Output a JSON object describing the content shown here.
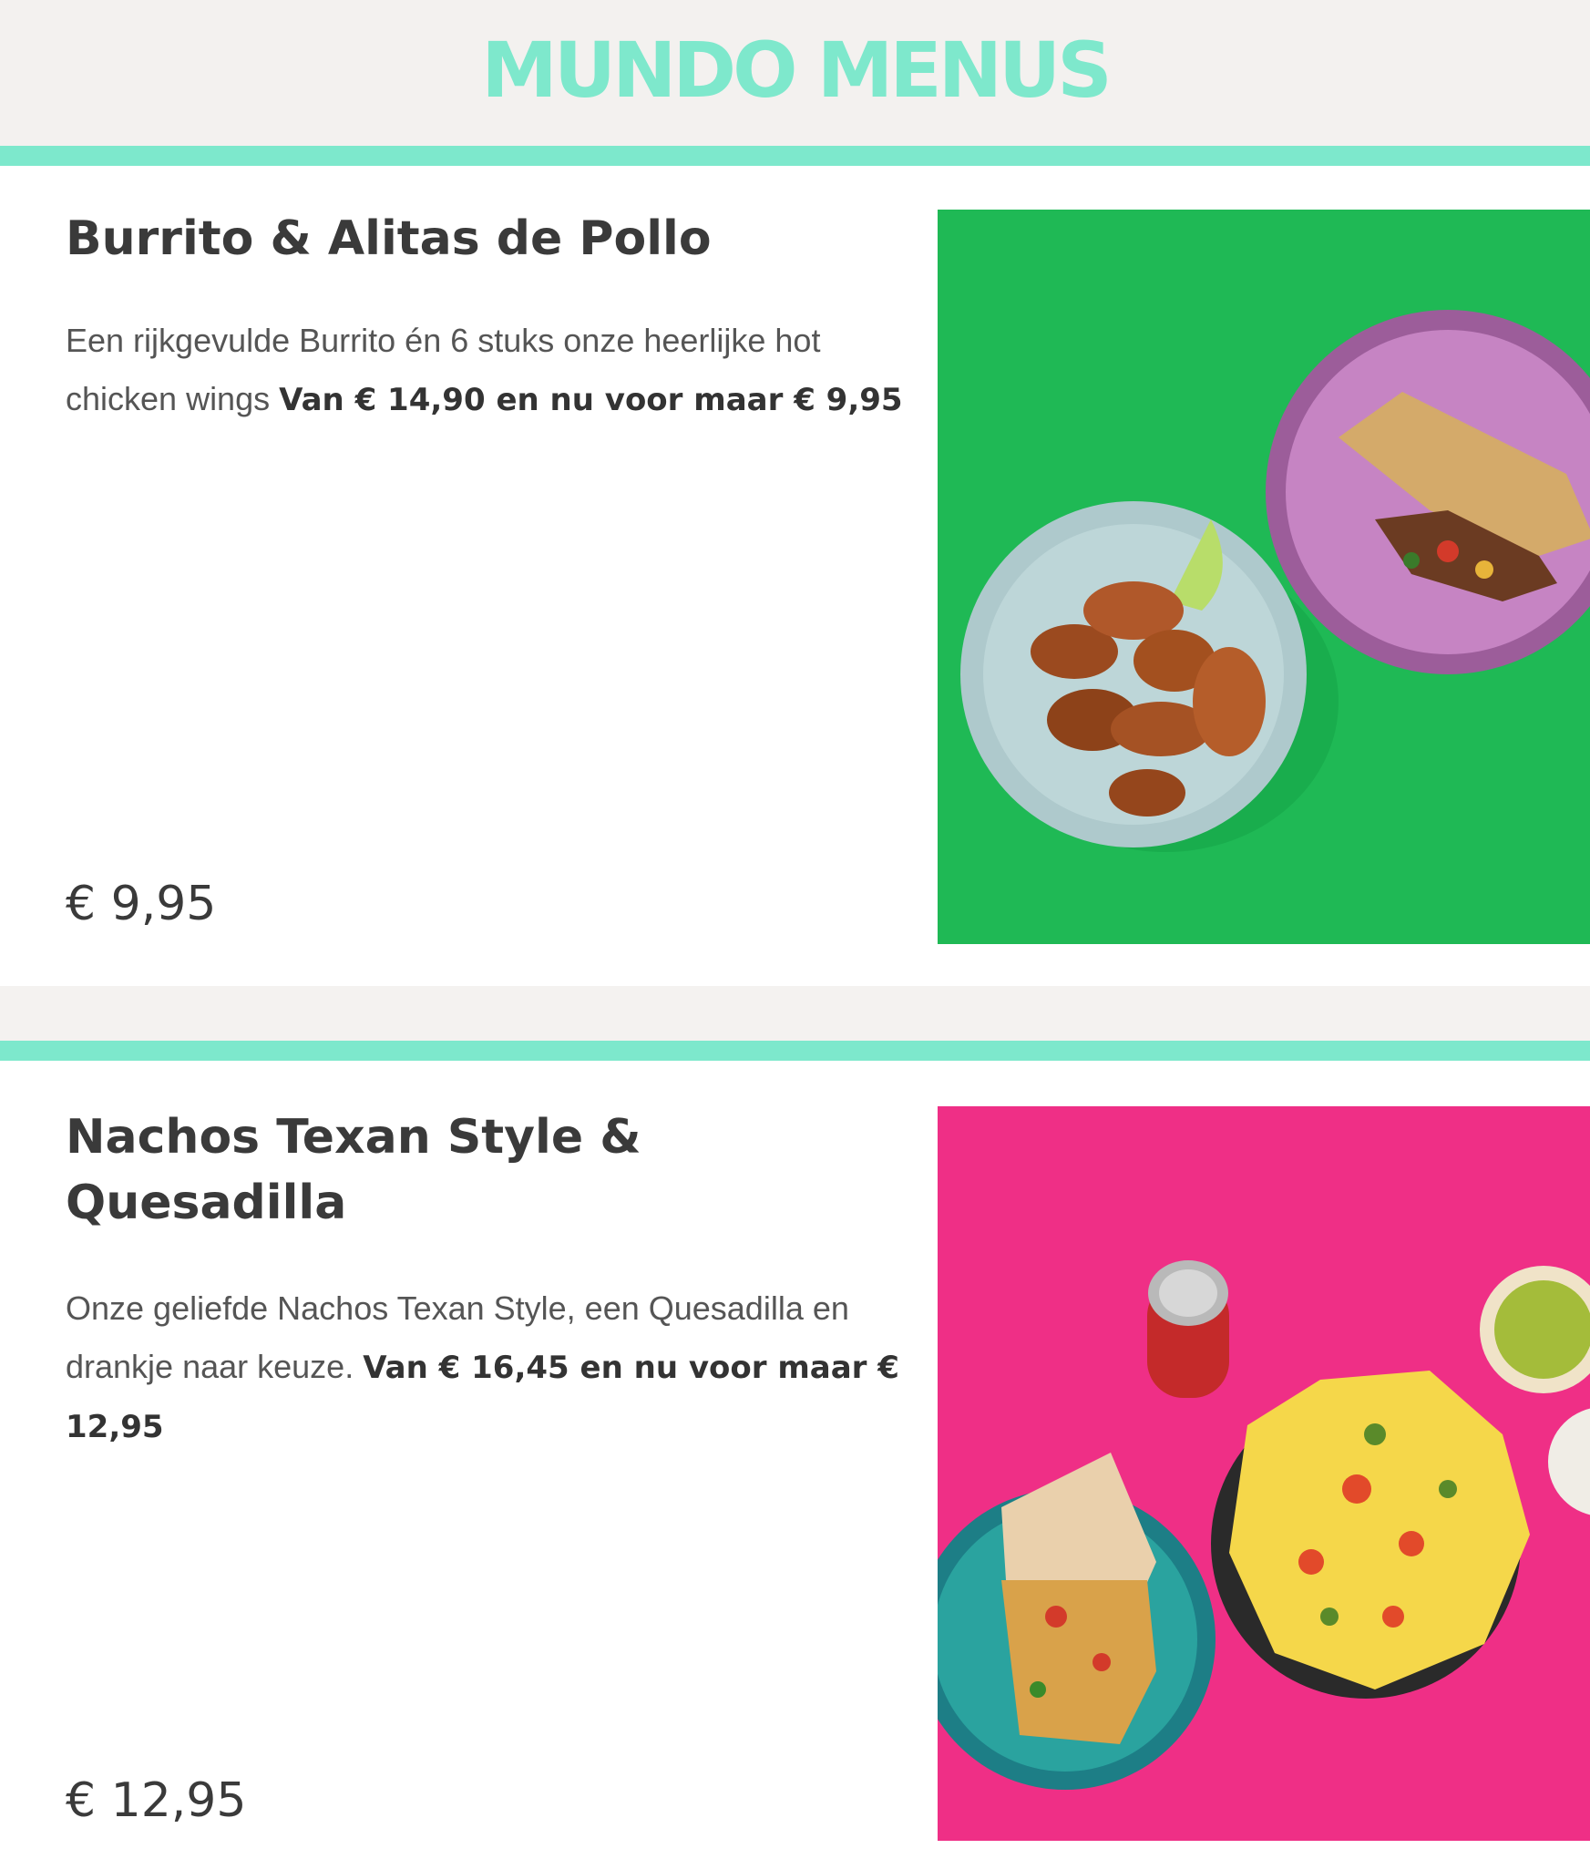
{
  "brand": {
    "name": "MUNDO MENUS"
  },
  "colors": {
    "accent": "#7de8cc",
    "photo1_bg": "#1fb955",
    "photo2_bg": "#ef2f86"
  },
  "items": [
    {
      "title": "Burrito & Alitas de Pollo",
      "description_text": "Een rijkgevulde Burrito én 6 stuks onze heerlijke hot chicken wings",
      "description_bold": "Van € 14,90 en nu voor maar € 9,95",
      "price": "€ 9,95",
      "image": "chicken-wings-and-burrito-photo"
    },
    {
      "title": "Nachos Texan Style & Quesadilla",
      "description_text": "Onze geliefde Nachos Texan Style, een Quesadilla en drankje naar keuze.",
      "description_bold": "Van € 16,45 en nu voor maar € 12,95",
      "price": "€ 12,95",
      "image": "nachos-quesadilla-cola-photo"
    }
  ]
}
